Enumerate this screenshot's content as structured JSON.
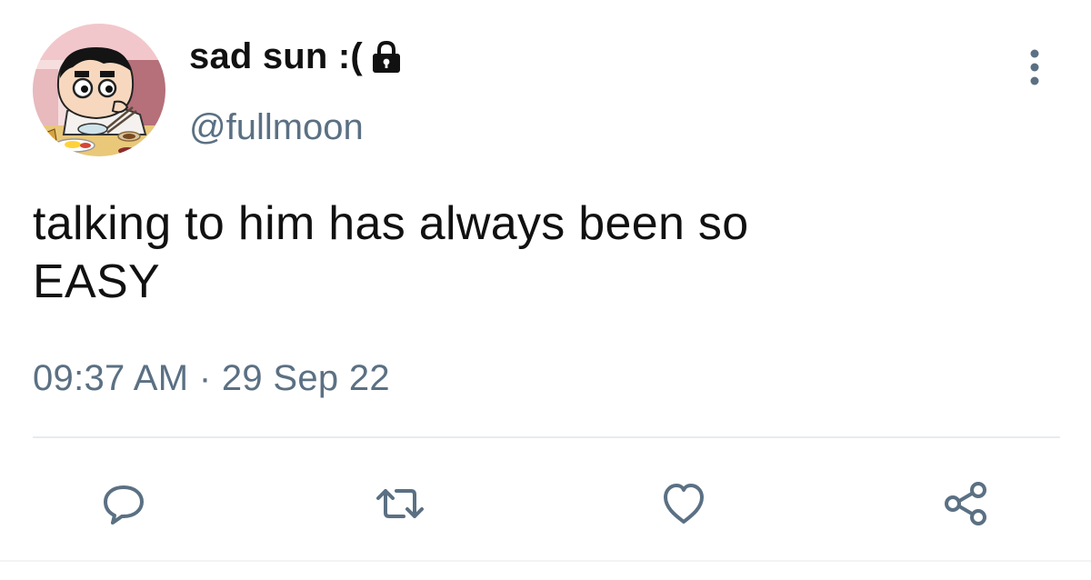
{
  "tweet": {
    "display_name": "sad sun :(",
    "handle": "@fullmoon",
    "text_line1": "talking to him has always been so",
    "text_line2": "EASY",
    "timestamp": "09:37 AM · 29 Sep 22"
  },
  "icons": {
    "lock": "lock-icon",
    "more": "vertical-ellipsis-icon",
    "reply": "speech-bubble-icon",
    "retweet": "retweet-arrows-icon",
    "like": "heart-icon",
    "share": "share-nodes-icon"
  },
  "colors": {
    "text": "#111111",
    "secondary": "#5b7083",
    "divider": "#e6ecf0",
    "icon": "#5b7083"
  }
}
